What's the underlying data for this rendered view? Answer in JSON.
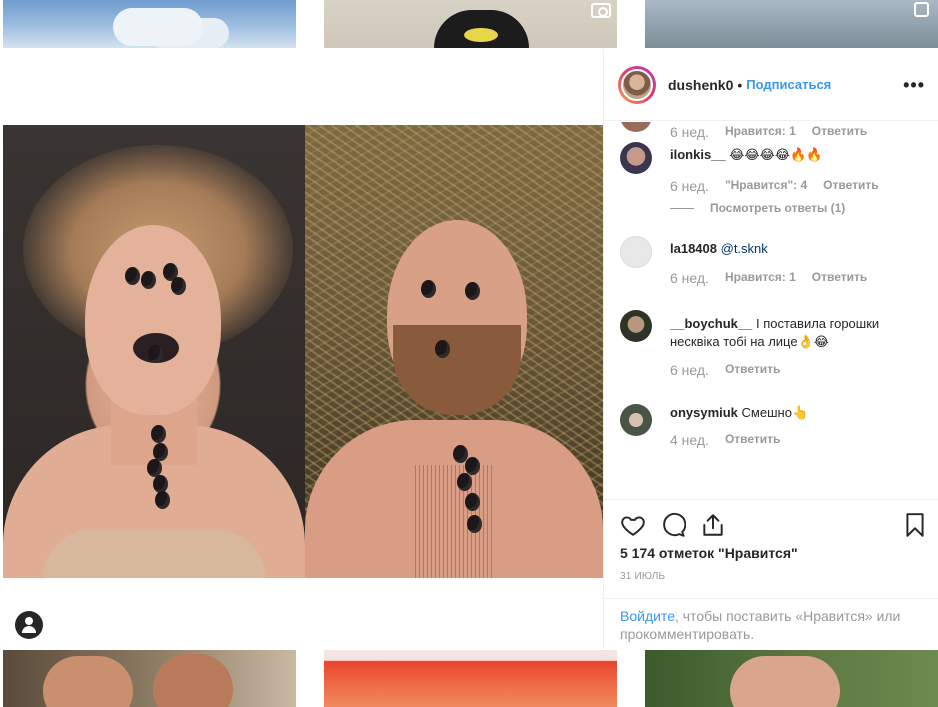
{
  "post": {
    "author": "dushenk0",
    "separator": "•",
    "follow_label": "Подписаться",
    "more_label": "•••",
    "likes_text": "5 174 отметок \"Нравится\"",
    "date": "31 ИЮЛЬ"
  },
  "comments": [
    {
      "user": "",
      "text": "",
      "time": "6 нед.",
      "likes": "Нравится: 1",
      "reply": "Ответить"
    },
    {
      "user": "ilonkis__",
      "text": "😂😂😂😂🔥🔥",
      "time": "6 нед.",
      "likes": "\"Нравится\": 4",
      "reply": "Ответить",
      "view_replies": "Посмотреть ответы (1)"
    },
    {
      "user": "la18408",
      "text": "@t.sknk",
      "time": "6 нед.",
      "likes": "Нравится: 1",
      "reply": "Ответить"
    },
    {
      "user": "__boychuk__",
      "text": "І поставила горошки несквіка тобі на лице👌😂",
      "time": "6 нед.",
      "likes": "",
      "reply": "Ответить"
    },
    {
      "user": "onysymiuk",
      "text": "Смешно👆",
      "time": "4 нед.",
      "likes": "",
      "reply": "Ответить"
    }
  ],
  "login_prompt": {
    "link": "Войдите",
    "rest": ", чтобы поставить «Нравится» или прокомментировать."
  },
  "icons": {
    "like": "heart-icon",
    "comment": "comment-icon",
    "share": "share-icon",
    "save": "bookmark-icon",
    "tag": "user-tag-icon"
  },
  "colors": {
    "link_blue": "#3897f0",
    "text": "#262626",
    "muted": "#999999",
    "border": "#efefef"
  }
}
